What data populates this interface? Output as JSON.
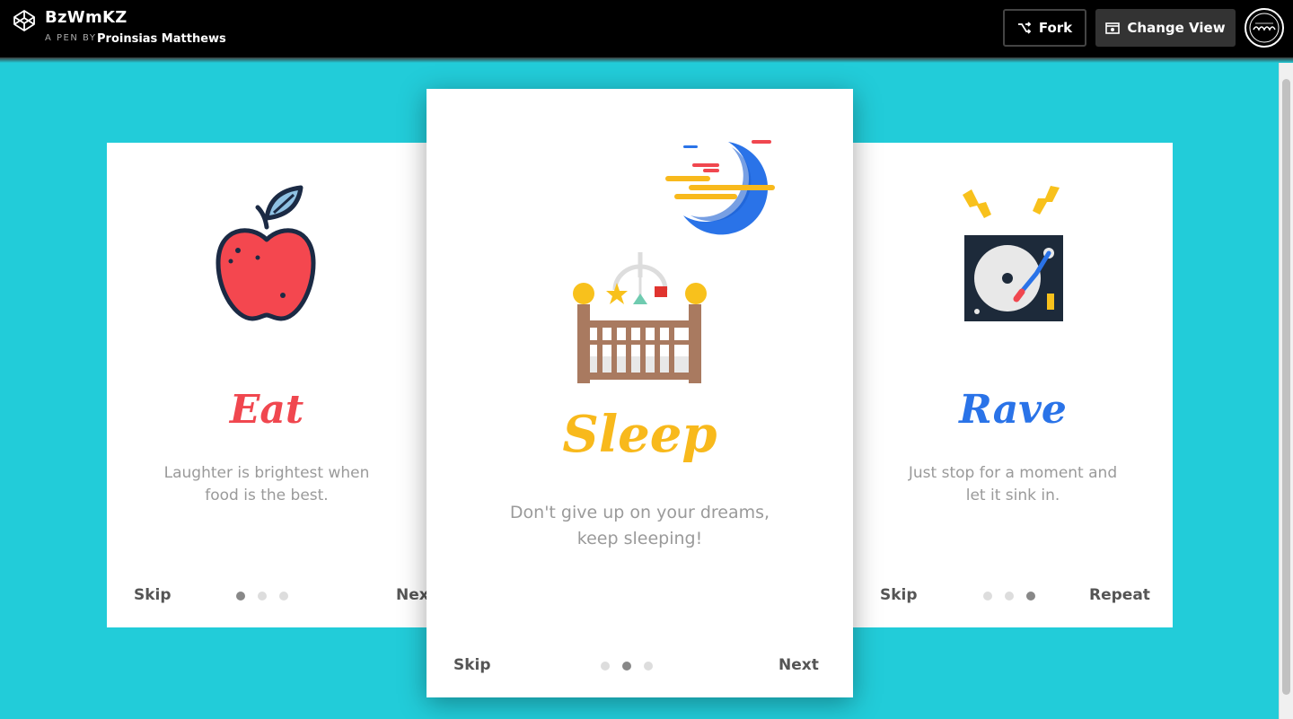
{
  "header": {
    "pen_title": "BzWmKZ",
    "pen_by_label": "A PEN BY",
    "author": "Proinsias Matthews",
    "fork_label": "Fork",
    "change_view_label": "Change View"
  },
  "cards": {
    "eat": {
      "title": "Eat",
      "text_line1": "Laughter is brightest when",
      "text_line2": "food is the best.",
      "skip": "Skip",
      "next": "Next",
      "active_dot": 1,
      "title_color": "#f0474f"
    },
    "sleep": {
      "title": "Sleep",
      "text_line1": "Don't give up on your dreams,",
      "text_line2": "keep sleeping!",
      "skip": "Skip",
      "next": "Next",
      "active_dot": 2,
      "title_color": "#f8b91c"
    },
    "rave": {
      "title": "Rave",
      "text_line1": "Just stop for a moment and",
      "text_line2": "let it sink in.",
      "skip": "Skip",
      "next": "Repeat",
      "active_dot": 3,
      "title_color": "#2a73e8"
    }
  },
  "colors": {
    "background": "#22ccd9",
    "topbar": "#000000"
  }
}
